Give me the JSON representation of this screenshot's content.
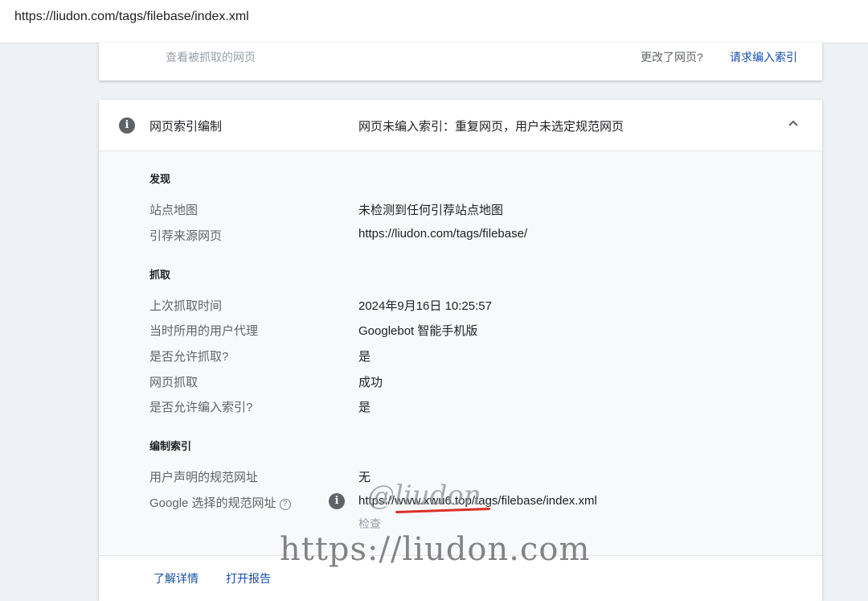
{
  "browser": {
    "url": "https://liudon.com/tags/filebase/index.xml"
  },
  "top_card": {
    "view_crawled_label": "查看被抓取的网页",
    "changed_question": "更改了网页?",
    "request_index_label": "请求编入索引"
  },
  "indexing_card": {
    "title": "网页索引编制",
    "status": "网页未编入索引：重复网页，用户未选定规范网页",
    "sections": {
      "discovery": {
        "title": "发现",
        "rows": [
          {
            "label": "站点地图",
            "value": "未检测到任何引荐站点地图"
          },
          {
            "label": "引荐来源网页",
            "value": "https://liudon.com/tags/filebase/"
          }
        ]
      },
      "crawl": {
        "title": "抓取",
        "rows": [
          {
            "label": "上次抓取时间",
            "value": "2024年9月16日 10:25:57"
          },
          {
            "label": "当时所用的用户代理",
            "value": "Googlebot 智能手机版"
          },
          {
            "label": "是否允许抓取?",
            "value": "是"
          },
          {
            "label": "网页抓取",
            "value": "成功"
          },
          {
            "label": "是否允许编入索引?",
            "value": "是"
          }
        ]
      },
      "indexing": {
        "title": "编制索引",
        "rows": [
          {
            "label": "用户声明的规范网址",
            "value": "无"
          },
          {
            "label": "Google 选择的规范网址",
            "help_glyph": "?",
            "value": "https://www.xwu6.top/tags/filebase/index.xml"
          }
        ],
        "inspect_label": "检查"
      }
    },
    "footer": {
      "learn_more": "了解详情",
      "open_report": "打开报告"
    }
  },
  "watermark": {
    "handle": "@liudon",
    "url": "https://liudon.com"
  },
  "icons": {
    "info": "info-icon",
    "collapse": "chevron-up-icon",
    "help": "help-circle-icon"
  }
}
